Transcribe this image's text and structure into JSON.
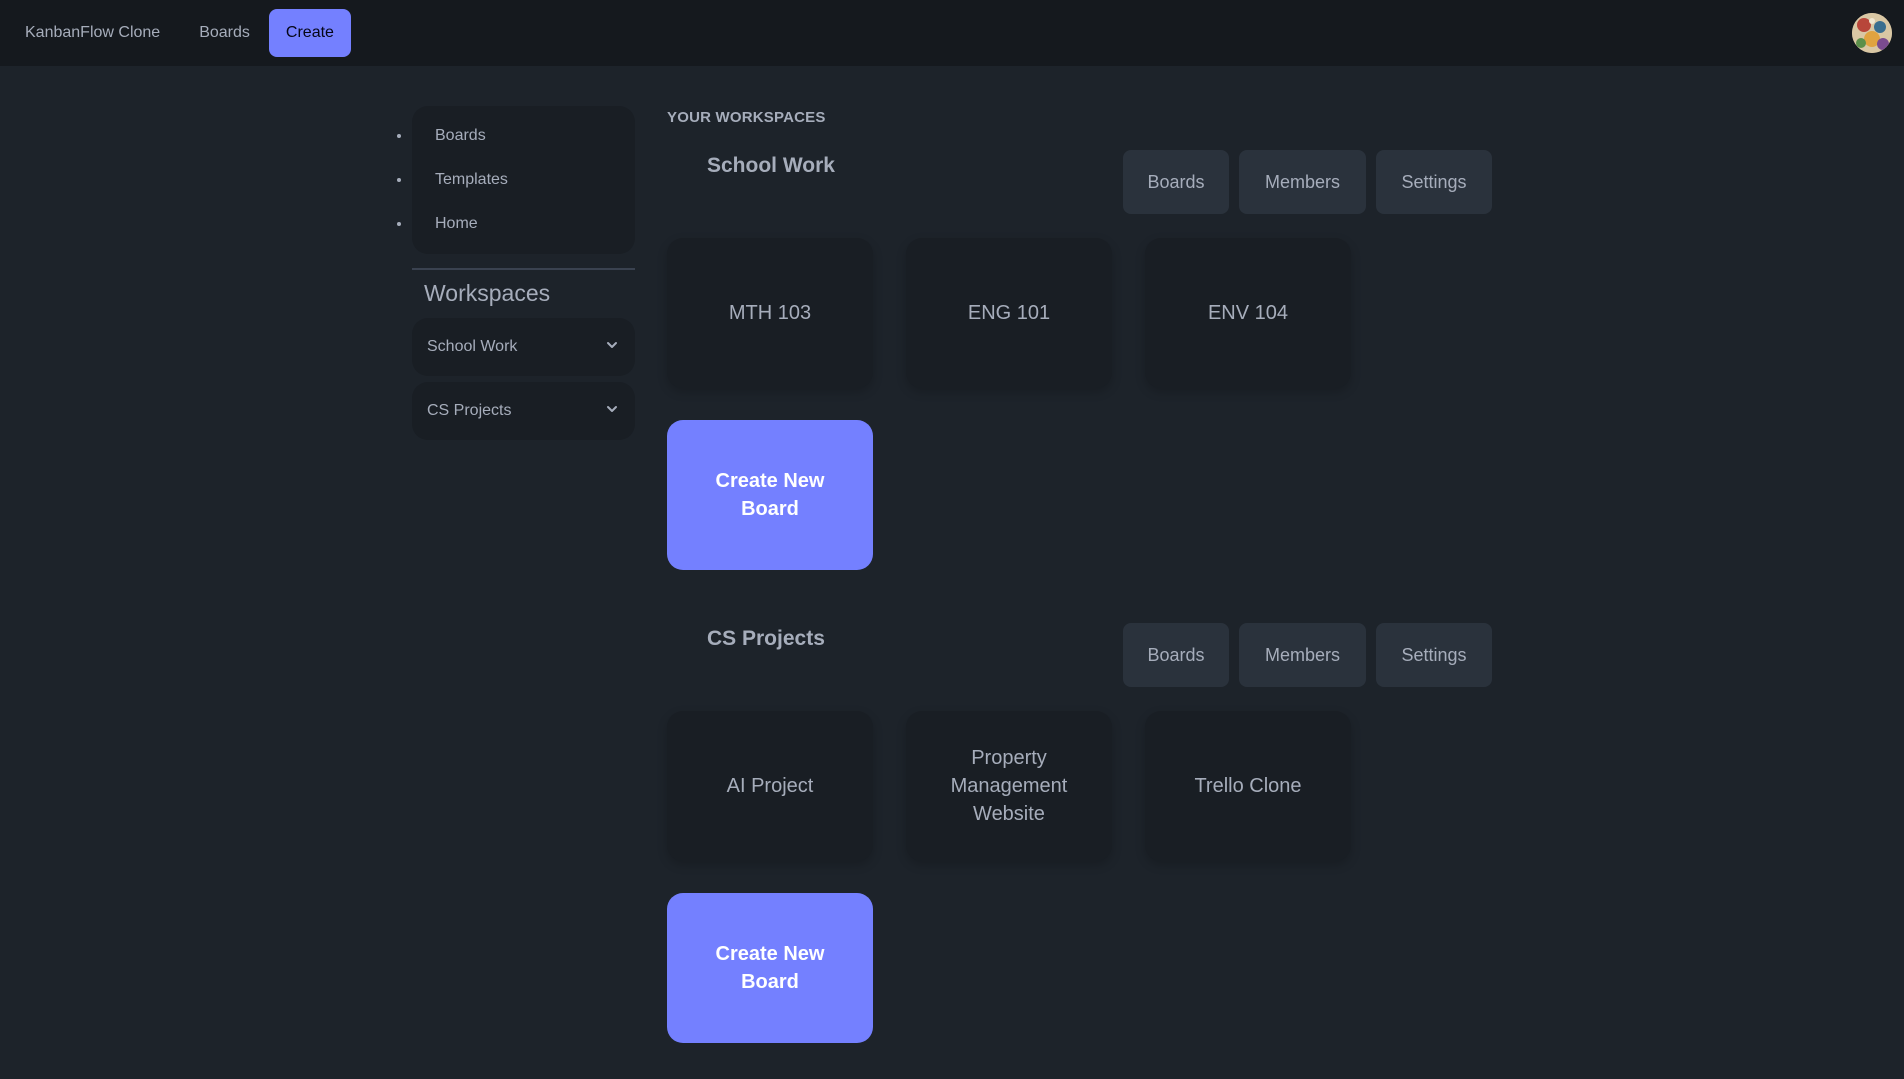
{
  "navbar": {
    "brand": "KanbanFlow Clone",
    "boards_label": "Boards",
    "create_label": "Create"
  },
  "sidebar": {
    "menu": [
      {
        "label": "Boards"
      },
      {
        "label": "Templates"
      },
      {
        "label": "Home"
      }
    ],
    "workspaces_heading": "Workspaces",
    "workspaces": [
      {
        "label": "School Work"
      },
      {
        "label": "CS Projects"
      }
    ]
  },
  "main": {
    "section_label": "YOUR WORKSPACES",
    "workspaces": [
      {
        "title": "School Work",
        "buttons": {
          "boards": "Boards",
          "members": "Members",
          "settings": "Settings"
        },
        "boards": [
          {
            "name": "MTH 103"
          },
          {
            "name": "ENG 101"
          },
          {
            "name": "ENV 104"
          }
        ],
        "create_label": "Create New Board"
      },
      {
        "title": "CS Projects",
        "buttons": {
          "boards": "Boards",
          "members": "Members",
          "settings": "Settings"
        },
        "boards": [
          {
            "name": "AI Project"
          },
          {
            "name": "Property Management Website"
          },
          {
            "name": "Trello Clone"
          }
        ],
        "create_label": "Create New Board"
      }
    ]
  },
  "colors": {
    "background": "#1d232a",
    "navbar": "#15191e",
    "card": "#191e24",
    "button": "#2a323c",
    "primary": "#7480ff",
    "text": "#a6adbb"
  }
}
